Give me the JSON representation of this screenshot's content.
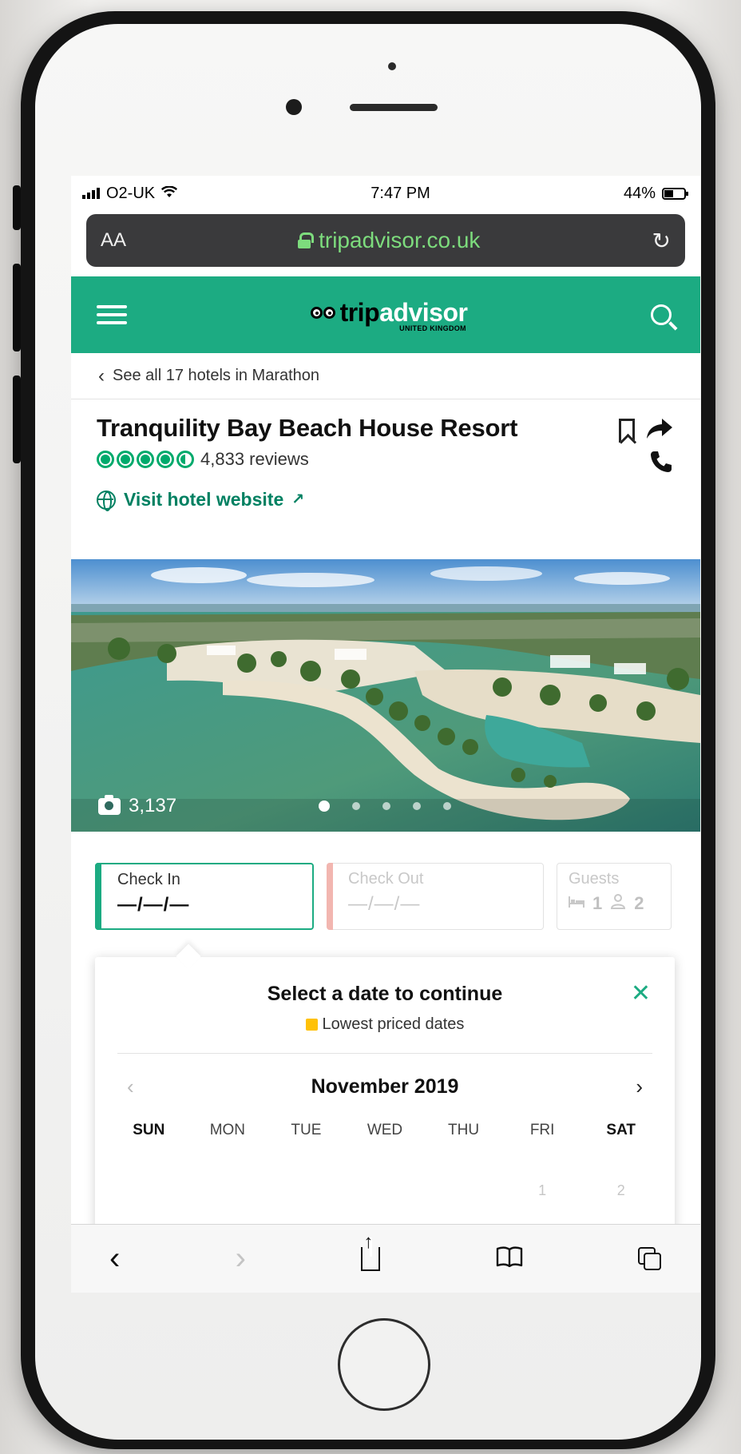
{
  "status_bar": {
    "carrier": "O2-UK",
    "time": "7:47 PM",
    "battery": "44%",
    "battery_level": 0.44,
    "icons": [
      "signal-icon",
      "wifi-icon",
      "battery-icon"
    ]
  },
  "browser": {
    "text_size_label": "AA",
    "url": "tripadvisor.co.uk",
    "icons": [
      "lock-icon",
      "reload-icon"
    ]
  },
  "header": {
    "logo_trip": "trip",
    "logo_advisor": "advisor",
    "logo_region": "UNITED KINGDOM",
    "brand_color": "#1cab82",
    "icons": [
      "menu-icon",
      "owl-logo-icon",
      "search-icon"
    ]
  },
  "breadcrumb": {
    "label": "See all 17 hotels in Marathon"
  },
  "hotel": {
    "name": "Tranquility Bay Beach House Resort",
    "rating": 4.5,
    "reviews": "4,833 reviews",
    "website_label": "Visit hotel website",
    "website_arrow": "↗",
    "icons": [
      "bookmark-icon",
      "share-icon",
      "phone-icon",
      "globe-icon"
    ]
  },
  "photo": {
    "count": "3,137",
    "slides": 5,
    "active_slide": 1,
    "icons": [
      "camera-icon"
    ]
  },
  "booking": {
    "check_in_label": "Check In",
    "check_in_value": "—/—/—",
    "check_out_label": "Check Out",
    "check_out_value": "—/—/—",
    "guests_label": "Guests",
    "rooms": "1",
    "guests": "2",
    "icons": [
      "bed-icon",
      "person-icon"
    ]
  },
  "calendar": {
    "title": "Select a date to continue",
    "legend": "Lowest priced dates",
    "legend_color": "#ffc107",
    "month": "November 2019",
    "weekdays": [
      "SUN",
      "MON",
      "TUE",
      "WED",
      "THU",
      "FRI",
      "SAT"
    ],
    "first_week": [
      "",
      "",
      "",
      "",
      "",
      "1",
      "2"
    ],
    "icons": [
      "close-icon",
      "chevron-left-icon",
      "chevron-right-icon"
    ]
  },
  "toolbar": {
    "icons": [
      "back-icon",
      "forward-icon",
      "share-icon",
      "bookmarks-icon",
      "tabs-icon"
    ]
  }
}
